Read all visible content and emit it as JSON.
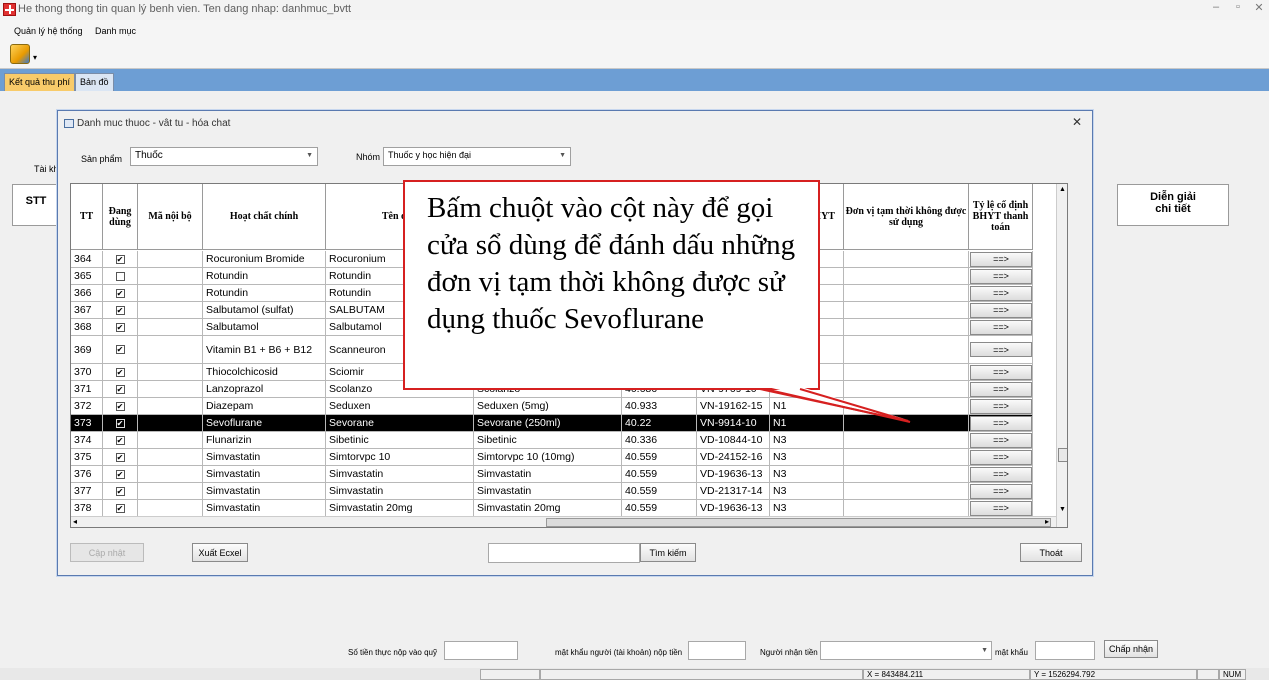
{
  "window": {
    "title": "He thong thong tin quan lý benh vien. Ten dang nhap: danhmuc_bvtt"
  },
  "menu": {
    "items": [
      "Quản lý hệ thống",
      "Danh mục"
    ]
  },
  "tabs": [
    "Kết quả thu phí",
    "Bản đồ"
  ],
  "background": {
    "stt": "STT",
    "dien_giai": "Diễn giải\nchi tiết",
    "tai_kh": "Tài kh"
  },
  "dialog": {
    "title": "Danh muc thuoc - vât tu - hóa chat",
    "san_pham_label": "Sản phẩm",
    "san_pham_value": "Thuốc",
    "nhom_label": "Nhóm",
    "nhom_value": "Thuốc y học hiện đại",
    "columns": [
      "TT",
      "Đang dùng",
      "Mã nội bộ",
      "Hoạt chất chính",
      "Tên đăn",
      "",
      "",
      "",
      "Nhóm BHYT",
      "Đơn vị tạm thời không được sử dụng",
      "Tỷ lệ cố định BHYT thanh toán"
    ],
    "rows": [
      {
        "tt": "364",
        "checked": true,
        "ma": "",
        "hoat_chat": "Rocuronium Bromide",
        "ten": "Rocuronium",
        "ten_dv": "",
        "gia": "",
        "so_dk": "",
        "nhom": "",
        "btn": "==>"
      },
      {
        "tt": "365",
        "checked": false,
        "ma": "",
        "hoat_chat": "Rotundin",
        "ten": "Rotundin",
        "ten_dv": "",
        "gia": "",
        "so_dk": "",
        "nhom": "",
        "btn": "==>"
      },
      {
        "tt": "366",
        "checked": true,
        "ma": "",
        "hoat_chat": "Rotundin",
        "ten": "Rotundin",
        "ten_dv": "",
        "gia": "",
        "so_dk": "",
        "nhom": "",
        "btn": "==>"
      },
      {
        "tt": "367",
        "checked": true,
        "ma": "",
        "hoat_chat": "Salbutamol (sulfat)",
        "ten": "SALBUTAM",
        "ten_dv": "",
        "gia": "",
        "so_dk": "",
        "nhom": "",
        "btn": "==>"
      },
      {
        "tt": "368",
        "checked": true,
        "ma": "",
        "hoat_chat": "Salbutamol",
        "ten": "Salbutamol",
        "ten_dv": "",
        "gia": "",
        "so_dk": "",
        "nhom": "",
        "btn": "==>"
      },
      {
        "tt": "369",
        "checked": true,
        "ma": "",
        "hoat_chat": "Vitamin B1 + B6 + B12",
        "ten": "Scanneuron",
        "ten_dv": "",
        "gia": "",
        "so_dk": "",
        "nhom": "",
        "btn": "==>"
      },
      {
        "tt": "370",
        "checked": true,
        "ma": "",
        "hoat_chat": "Thiocolchicosid",
        "ten": "Sciomir",
        "ten_dv": "",
        "gia": "",
        "so_dk": "",
        "nhom": "",
        "btn": "==>"
      },
      {
        "tt": "371",
        "checked": true,
        "ma": "",
        "hoat_chat": "Lanzoprazol",
        "ten": "Scolanzo",
        "ten_dv": "Scolanzo",
        "gia": "40.686",
        "so_dk": "VN-9769-10",
        "nhom": "N1",
        "btn": "==>"
      },
      {
        "tt": "372",
        "checked": true,
        "ma": "",
        "hoat_chat": "Diazepam",
        "ten": "Seduxen",
        "ten_dv": "Seduxen (5mg)",
        "gia": "40.933",
        "so_dk": "VN-19162-15",
        "nhom": "N1",
        "btn": "==>"
      },
      {
        "tt": "373",
        "checked": true,
        "ma": "",
        "hoat_chat": "Sevoflurane",
        "ten": "Sevorane",
        "ten_dv": "Sevorane (250ml)",
        "gia": "40.22",
        "so_dk": "VN-9914-10",
        "nhom": "N1",
        "btn": "==>"
      },
      {
        "tt": "374",
        "checked": true,
        "ma": "",
        "hoat_chat": "Flunarizin",
        "ten": "Sibetinic",
        "ten_dv": "Sibetinic",
        "gia": "40.336",
        "so_dk": "VD-10844-10",
        "nhom": "N3",
        "btn": "==>"
      },
      {
        "tt": "375",
        "checked": true,
        "ma": "",
        "hoat_chat": "Simvastatin",
        "ten": "Simtorvpc 10",
        "ten_dv": "Simtorvpc 10 (10mg)",
        "gia": "40.559",
        "so_dk": "VD-24152-16",
        "nhom": "N3",
        "btn": "==>"
      },
      {
        "tt": "376",
        "checked": true,
        "ma": "",
        "hoat_chat": "Simvastatin",
        "ten": "Simvastatin",
        "ten_dv": "Simvastatin",
        "gia": "40.559",
        "so_dk": "VD-19636-13",
        "nhom": "N3",
        "btn": "==>"
      },
      {
        "tt": "377",
        "checked": true,
        "ma": "",
        "hoat_chat": "Simvastatin",
        "ten": "Simvastatin",
        "ten_dv": "Simvastatin",
        "gia": "40.559",
        "so_dk": "VD-21317-14",
        "nhom": "N3",
        "btn": "==>"
      },
      {
        "tt": "378",
        "checked": true,
        "ma": "",
        "hoat_chat": "Simvastatin",
        "ten": "Simvastatin 20mg",
        "ten_dv": "Simvastatin 20mg",
        "gia": "40.559",
        "so_dk": "VD-19636-13",
        "nhom": "N3",
        "btn": "==>"
      }
    ],
    "buttons": {
      "cap_nhat": "Cập nhật",
      "xuat_excel": "Xuất Ecxel",
      "tim_kiem": "Tìm kiếm",
      "thoat": "Thoát"
    }
  },
  "callout": {
    "text": "Bấm chuột vào cột này để gọi cửa sổ dùng để đánh dấu những đơn vị tạm thời không được sử dụng thuốc Sevoflurane"
  },
  "bottom": {
    "so_tien": "Số tiền thực nộp vào quỹ",
    "mat_khau_nguoi_nop": "mật khẩu người (tài khoản) nộp tiền",
    "nguoi_nhan": "Người nhận tiền",
    "mat_khau": "mật khẩu",
    "chap_nhan": "Chấp nhận"
  },
  "status": {
    "x": "X = 843484.211",
    "y": "Y = 1526294.792",
    "num": "NUM"
  }
}
